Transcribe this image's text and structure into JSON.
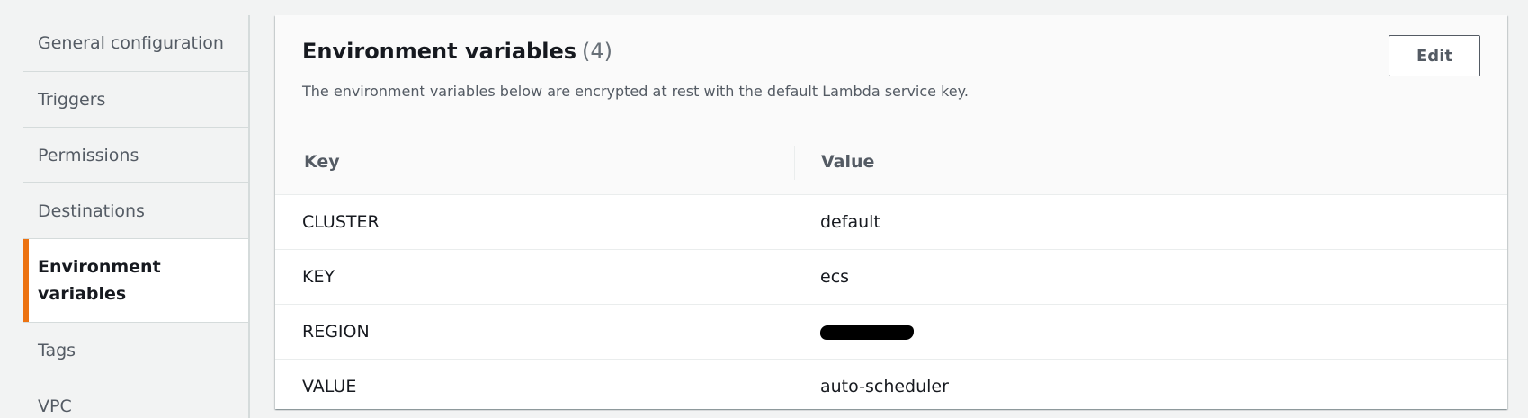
{
  "sidebar": {
    "items": [
      {
        "label": "General configuration"
      },
      {
        "label": "Triggers"
      },
      {
        "label": "Permissions"
      },
      {
        "label": "Destinations"
      },
      {
        "label": "Environment variables"
      },
      {
        "label": "Tags"
      },
      {
        "label": "VPC"
      }
    ],
    "active_index": 4
  },
  "panel": {
    "title": "Environment variables",
    "count": "(4)",
    "description": "The environment variables below are encrypted at rest with the default Lambda service key.",
    "edit_label": "Edit"
  },
  "table": {
    "headers": {
      "key": "Key",
      "value": "Value"
    },
    "rows": [
      {
        "key": "CLUSTER",
        "value": "default"
      },
      {
        "key": "KEY",
        "value": "ecs"
      },
      {
        "key": "REGION",
        "value": ""
      },
      {
        "key": "VALUE",
        "value": "auto-scheduler"
      }
    ]
  },
  "colors": {
    "accent": "#ec7211",
    "text": "#16191f",
    "muted": "#545b64",
    "border": "#eaeded"
  }
}
